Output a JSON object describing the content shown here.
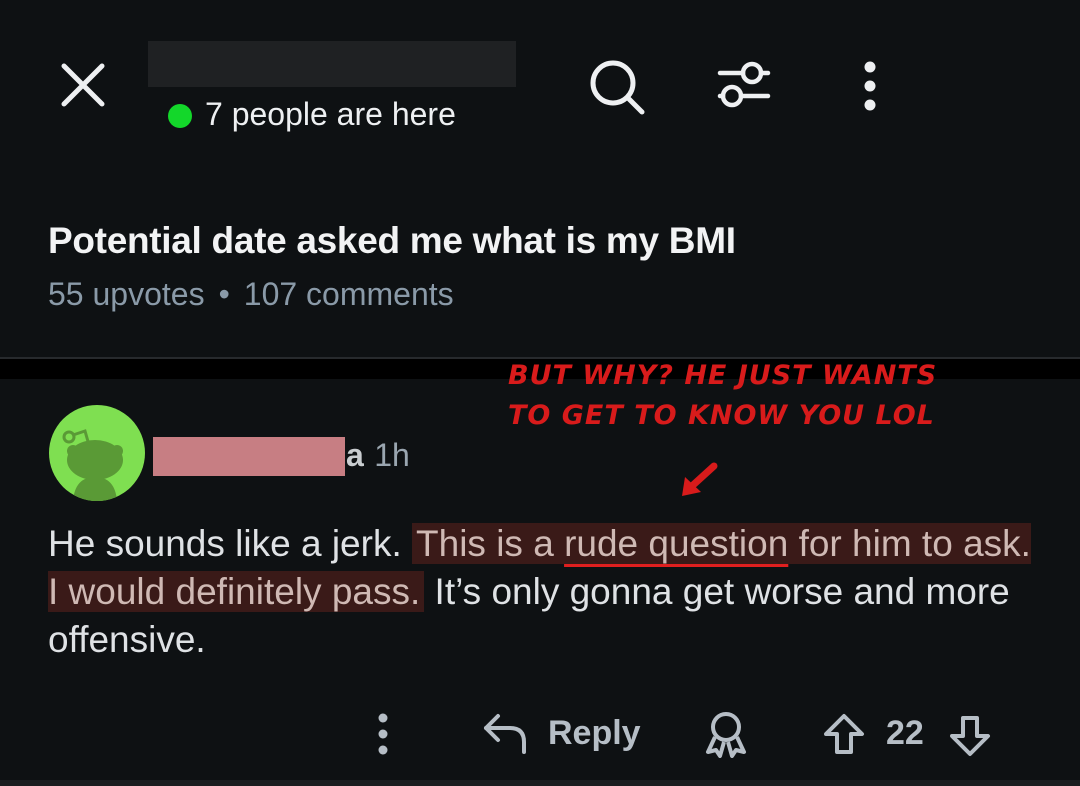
{
  "header": {
    "close_icon": "close-icon",
    "online_status": "7 people are here",
    "status_color": "#13d72a",
    "search_icon": "search-icon",
    "filter_icon": "filter-icon",
    "more_icon": "more-vertical-icon"
  },
  "post": {
    "title": "Potential date asked me what is my BMI",
    "upvotes": "55 upvotes",
    "separator": "•",
    "comments": "107 comments"
  },
  "annotation": {
    "line1": "BUT WHY? HE JUST WANTS",
    "line2": "TO GET TO KNOW YOU LOL",
    "color": "#d81b1b"
  },
  "comment": {
    "username_tail": "a",
    "age": "1h",
    "text_plain_1": "He sounds like a jerk.",
    "text_highlight_1": "This is a",
    "text_underlined": "rude question",
    "text_highlight_2": "for him to ask. I would definitely pass.",
    "text_plain_2": "It’s only gonna get worse and more offensive.",
    "highlight_color": "#3a1a18",
    "avatar_color": "#7fdf51"
  },
  "actions": {
    "reply_label": "Reply",
    "vote_count": "22"
  }
}
